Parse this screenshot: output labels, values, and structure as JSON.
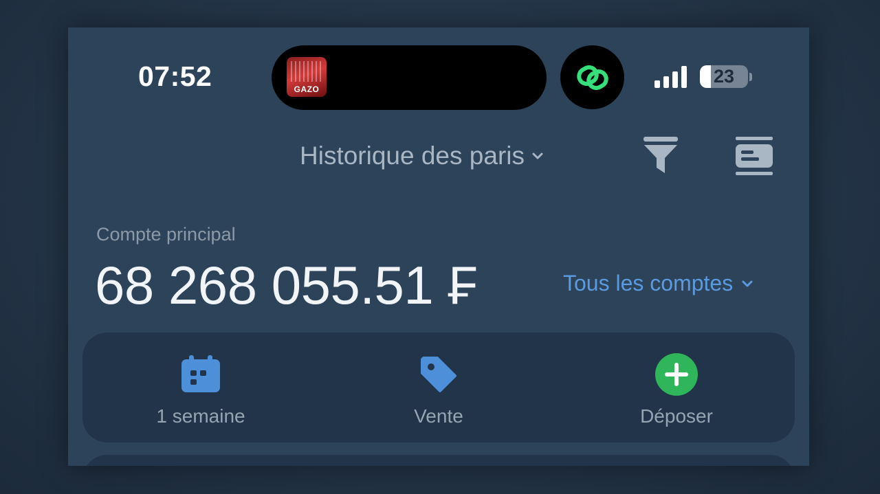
{
  "status_bar": {
    "time": "07:52",
    "now_playing_album_text": "GAZO",
    "battery_level": "23",
    "signal_bars": 4,
    "icons": {
      "activity": "link-rings-icon",
      "signal": "cellular-signal-icon",
      "battery": "battery-icon"
    }
  },
  "header": {
    "title": "Historique des paris",
    "title_icon": "chevron-down-icon",
    "right_icons": [
      "filter-icon",
      "card-view-icon"
    ]
  },
  "account": {
    "label": "Compte principal",
    "balance": "68 268 055.51 ₣",
    "switch_label": "Tous les comptes",
    "switch_icon": "chevron-down-icon"
  },
  "actions": [
    {
      "label": "1 semaine",
      "icon": "calendar-icon"
    },
    {
      "label": "Vente",
      "icon": "tag-icon"
    },
    {
      "label": "Déposer",
      "icon": "plus-circle-icon"
    }
  ],
  "colors": {
    "background": "#2d4359",
    "panel": "#22344a",
    "accent_blue": "#5a9ae0",
    "accent_green": "#2fb55a",
    "link_green": "#35e07a",
    "muted_text": "#97a5b3"
  }
}
